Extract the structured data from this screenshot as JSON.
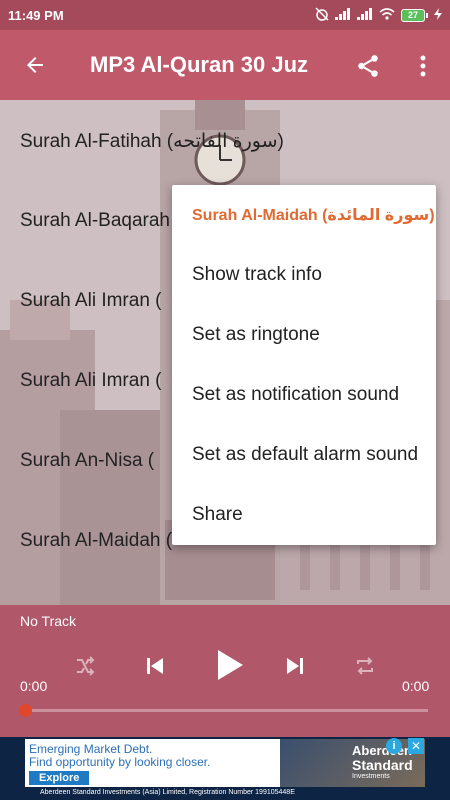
{
  "status_bar": {
    "time": "11:49 PM",
    "battery_level": "27"
  },
  "app_bar": {
    "title": "MP3 Al-Quran 30 Juz"
  },
  "list": {
    "items": [
      "Surah Al-Fatihah (سورة الفاتحه)",
      "Surah Al-Baqarah",
      "Surah Ali Imran (",
      "Surah Ali Imran (",
      "Surah An-Nisa (",
      "Surah Al-Maidah ("
    ]
  },
  "menu": {
    "header": "Surah Al-Maidah (سورة المائدة)",
    "items": [
      "Show track info",
      "Set as ringtone",
      "Set as notification sound",
      "Set as default alarm sound",
      "Share"
    ]
  },
  "player": {
    "track": "No Track",
    "time_elapsed": "0:00",
    "time_total": "0:00",
    "progress": 0
  },
  "ad": {
    "line1": "Emerging Market Debt.",
    "line2": "Find opportunity by looking closer.",
    "cta": "Explore",
    "brand_line1": "Aberdeen",
    "brand_line2": "Standard",
    "brand_line3": "Investments",
    "info_glyph": "i",
    "close_glyph": "✕",
    "footer": "Aberdeen Standard Investments (Asia) Limited, Registration Number 199105448E"
  },
  "colors": {
    "app_bar": "#c05a6a",
    "status_bar": "#a44a5b",
    "menu_header": "#e06a32",
    "seek_thumb": "#e0462a"
  }
}
